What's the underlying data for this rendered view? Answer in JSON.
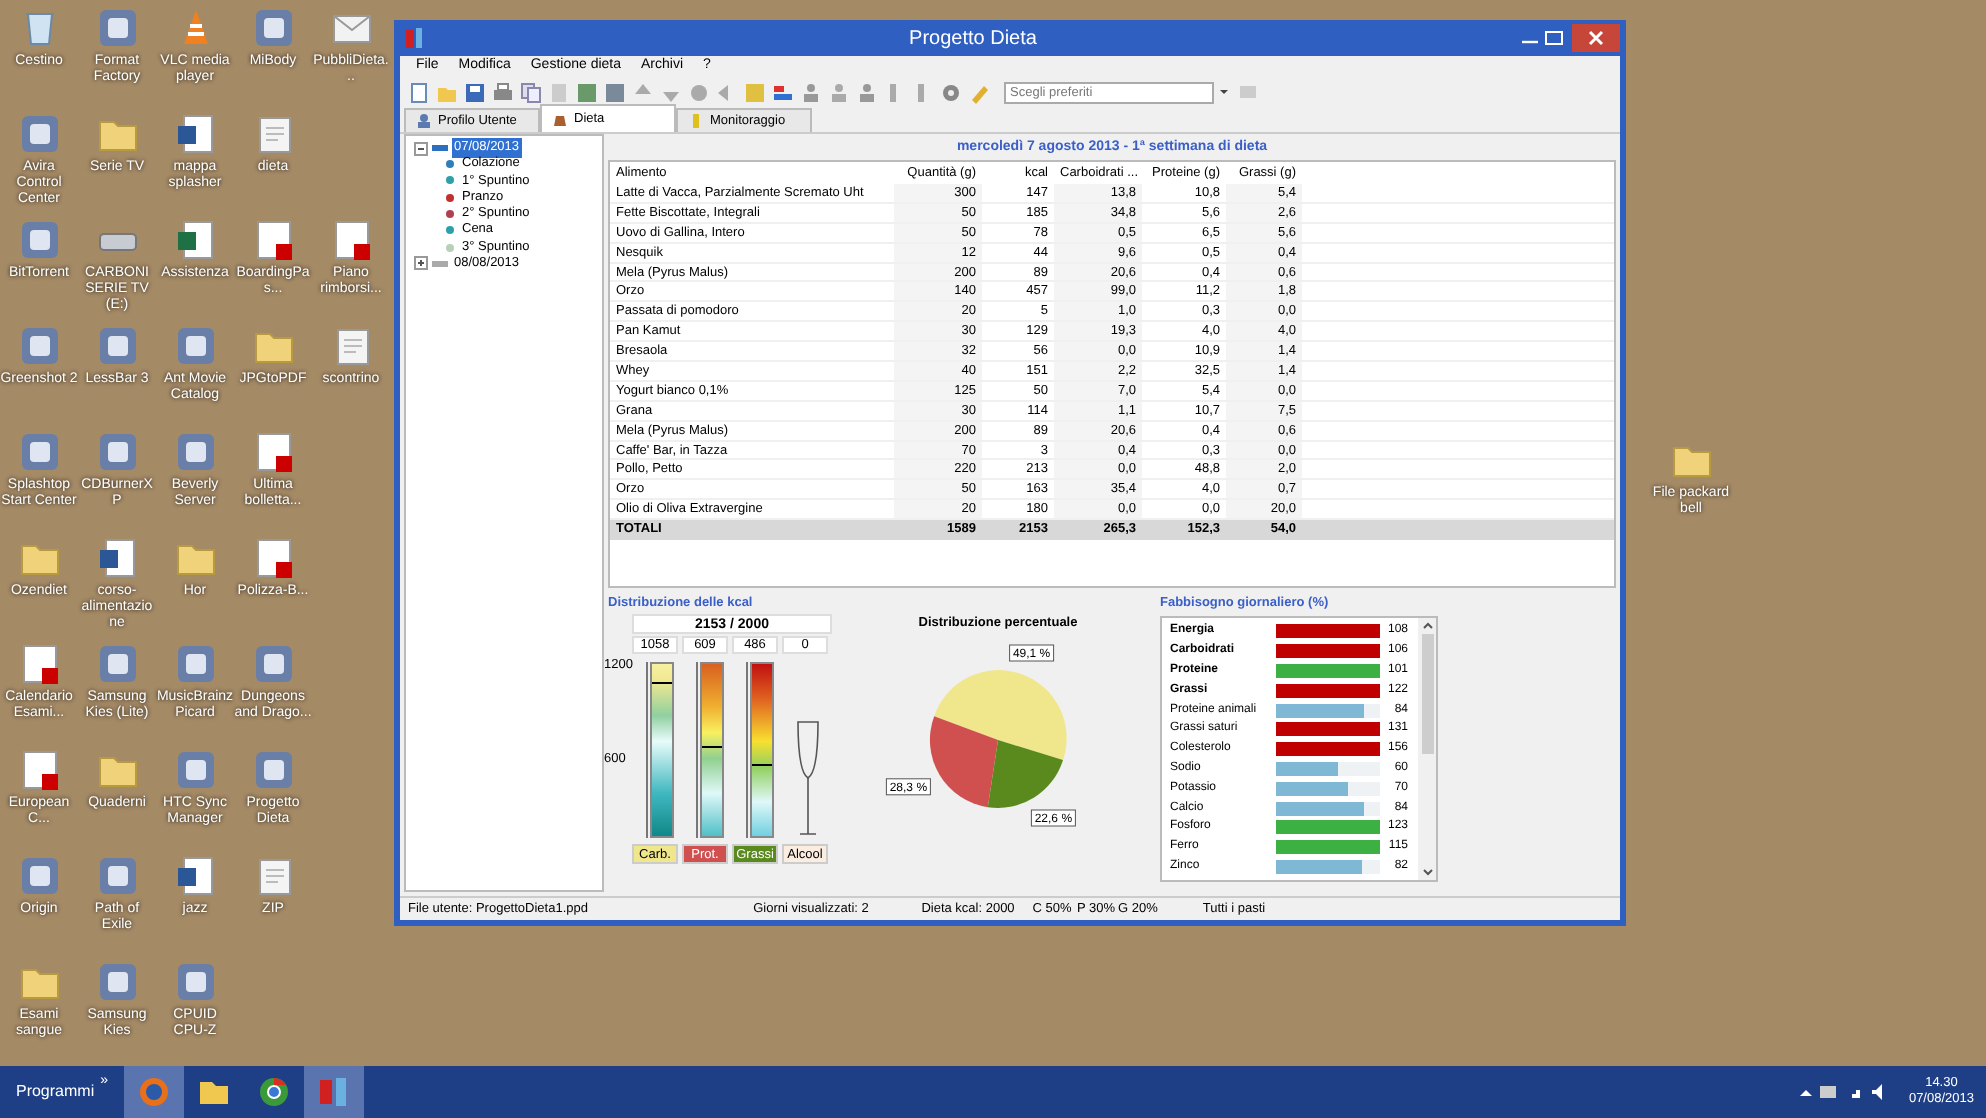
{
  "desktop": {
    "icon_rows": [
      [
        {
          "label": "Cestino",
          "kind": "recycle"
        },
        {
          "label": "Format Factory",
          "kind": "app"
        },
        {
          "label": "VLC media player",
          "kind": "cone"
        },
        {
          "label": "MiBody",
          "kind": "app"
        },
        {
          "label": "PubbliDieta...",
          "kind": "mail"
        }
      ],
      [
        {
          "label": "Avira Control Center",
          "kind": "app"
        },
        {
          "label": "Serie TV",
          "kind": "folder"
        },
        {
          "label": "mappa splasher",
          "kind": "word"
        },
        {
          "label": "dieta",
          "kind": "doc"
        }
      ],
      [
        {
          "label": "BitTorrent",
          "kind": "app"
        },
        {
          "label": "CARBONI SERIE TV (E:)",
          "kind": "drive"
        },
        {
          "label": "Assistenza",
          "kind": "excel"
        },
        {
          "label": "BoardingPas...",
          "kind": "pdf"
        },
        {
          "label": "Piano rimborsi...",
          "kind": "pdf"
        }
      ],
      [
        {
          "label": "Greenshot 2",
          "kind": "app"
        },
        {
          "label": "LessBar 3",
          "kind": "app"
        },
        {
          "label": "Ant Movie Catalog",
          "kind": "app"
        },
        {
          "label": "JPGtoPDF",
          "kind": "folder"
        },
        {
          "label": "scontrino",
          "kind": "doc"
        }
      ],
      [
        {
          "label": "Splashtop Start Center",
          "kind": "app"
        },
        {
          "label": "CDBurnerXP",
          "kind": "app"
        },
        {
          "label": "Beverly Server",
          "kind": "app"
        },
        {
          "label": "Ultima bolletta...",
          "kind": "pdf"
        }
      ],
      [
        {
          "label": "Ozendiet",
          "kind": "folder"
        },
        {
          "label": "corso-alimentazione",
          "kind": "word"
        },
        {
          "label": "Hor",
          "kind": "folder"
        },
        {
          "label": "Polizza-B...",
          "kind": "pdf"
        }
      ],
      [
        {
          "label": "Calendario Esami...",
          "kind": "pdf"
        },
        {
          "label": "Samsung Kies (Lite)",
          "kind": "app"
        },
        {
          "label": "MusicBrainz Picard",
          "kind": "app"
        },
        {
          "label": "Dungeons and Drago...",
          "kind": "app"
        }
      ],
      [
        {
          "label": "European C...",
          "kind": "pdf"
        },
        {
          "label": "Quaderni",
          "kind": "folder"
        },
        {
          "label": "HTC Sync Manager",
          "kind": "app"
        },
        {
          "label": "Progetto Dieta",
          "kind": "app"
        }
      ],
      [
        {
          "label": "Origin",
          "kind": "app"
        },
        {
          "label": "Path of Exile",
          "kind": "app"
        },
        {
          "label": "jazz",
          "kind": "word"
        },
        {
          "label": "ZIP",
          "kind": "doc"
        }
      ],
      [
        {
          "label": "Esami sangue",
          "kind": "folder"
        },
        {
          "label": "Samsung Kies",
          "kind": "app"
        },
        {
          "label": "CPUID CPU-Z",
          "kind": "app"
        }
      ]
    ],
    "right_icon": {
      "label": "File packard bell",
      "kind": "folder"
    }
  },
  "window": {
    "title": "Progetto Dieta",
    "menu": [
      "File",
      "Modifica",
      "Gestione dieta",
      "Archivi",
      "?"
    ],
    "favorites": {
      "placeholder": "Scegli preferiti"
    },
    "tabs": [
      {
        "label": "Profilo Utente",
        "selected": false
      },
      {
        "label": "Dieta",
        "selected": true
      },
      {
        "label": "Monitoraggio",
        "selected": false
      }
    ],
    "tree": [
      {
        "label": "07/08/2013",
        "selected": true,
        "expanded": true,
        "children": [
          {
            "label": "Colazione",
            "color": "#2c7fb8"
          },
          {
            "label": "1° Spuntino",
            "color": "#2c9fa8"
          },
          {
            "label": "Pranzo",
            "color": "#c03030"
          },
          {
            "label": "2° Spuntino",
            "color": "#b04050"
          },
          {
            "label": "Cena",
            "color": "#2c9fa8"
          },
          {
            "label": "3° Spuntino",
            "color": "#b8d0b8"
          }
        ]
      },
      {
        "label": "08/08/2013",
        "selected": false,
        "expanded": false
      }
    ],
    "day_title": "mercoledì 7 agosto 2013 - 1ª settimana di dieta",
    "table": {
      "columns": [
        "Alimento",
        "Quantità (g)",
        "kcal",
        "Carboidrati ...",
        "Proteine (g)",
        "Grassi (g)"
      ],
      "rows": [
        [
          "Latte di Vacca, Parzialmente Scremato Uht",
          "300",
          "147",
          "13,8",
          "10,8",
          "5,4"
        ],
        [
          "Fette Biscottate, Integrali",
          "50",
          "185",
          "34,8",
          "5,6",
          "2,6"
        ],
        [
          "Uovo di Gallina, Intero",
          "50",
          "78",
          "0,5",
          "6,5",
          "5,6"
        ],
        [
          "Nesquik",
          "12",
          "44",
          "9,6",
          "0,5",
          "0,4"
        ],
        [
          "Mela (Pyrus Malus)",
          "200",
          "89",
          "20,6",
          "0,4",
          "0,6"
        ],
        [
          "Orzo",
          "140",
          "457",
          "99,0",
          "11,2",
          "1,8"
        ],
        [
          "Passata di pomodoro",
          "20",
          "5",
          "1,0",
          "0,3",
          "0,0"
        ],
        [
          "Pan Kamut",
          "30",
          "129",
          "19,3",
          "4,0",
          "4,0"
        ],
        [
          "Bresaola",
          "32",
          "56",
          "0,0",
          "10,9",
          "1,4"
        ],
        [
          "Whey",
          "40",
          "151",
          "2,2",
          "32,5",
          "1,4"
        ],
        [
          "Yogurt bianco 0,1%",
          "125",
          "50",
          "7,0",
          "5,4",
          "0,0"
        ],
        [
          "Grana",
          "30",
          "114",
          "1,1",
          "10,7",
          "7,5"
        ],
        [
          "Mela (Pyrus Malus)",
          "200",
          "89",
          "20,6",
          "0,4",
          "0,6"
        ],
        [
          "Caffe' Bar, in Tazza",
          "70",
          "3",
          "0,4",
          "0,3",
          "0,0"
        ],
        [
          "Pollo, Petto",
          "220",
          "213",
          "0,0",
          "48,8",
          "2,0"
        ],
        [
          "Orzo",
          "50",
          "163",
          "35,4",
          "4,0",
          "0,7"
        ],
        [
          "Olio di Oliva Extravergine",
          "20",
          "180",
          "0,0",
          "0,0",
          "20,0"
        ]
      ],
      "total": [
        "TOTALI",
        "1589",
        "2153",
        "265,3",
        "152,3",
        "54,0"
      ]
    },
    "kcal_panel": {
      "title": "Distribuzione delle kcal",
      "total": "2153 / 2000",
      "values": [
        "1058",
        "609",
        "486",
        "0"
      ],
      "axis": [
        "1200",
        "600"
      ],
      "meters": [
        {
          "label": "Carb.",
          "kind": "carb",
          "level": 0.88
        },
        {
          "label": "Prot.",
          "kind": "prot",
          "level": 0.51
        },
        {
          "label": "Grassi",
          "kind": "fat",
          "level": 0.405
        },
        {
          "label": "Alcool",
          "kind": "glass"
        }
      ]
    },
    "pie": {
      "chart_data": {
        "type": "pie",
        "title": "Distribuzione percentuale",
        "values": [
          49.1,
          28.3,
          22.6
        ],
        "value_labels": [
          "49,1 %",
          "28,3 %",
          "22,6 %"
        ]
      }
    },
    "needs": {
      "title": "Fabbisogno giornaliero (%)",
      "rows": [
        {
          "name": "Energia",
          "kind": "main",
          "level": 1,
          "value": "108",
          "color": "#c00000"
        },
        {
          "name": "Carboidrati",
          "kind": "main",
          "level": 1,
          "value": "106",
          "color": "#c00000"
        },
        {
          "name": "Proteine",
          "kind": "main",
          "level": 1,
          "value": "101",
          "color": "#3cb043"
        },
        {
          "name": "Grassi",
          "kind": "main",
          "level": 1,
          "value": "122",
          "color": "#c00000"
        },
        {
          "name": "Proteine animali",
          "kind": "detail",
          "level": 0.84,
          "value": "84",
          "color": "#7fb8d4"
        },
        {
          "name": "Grassi saturi",
          "kind": "detail",
          "level": 1,
          "value": "131",
          "color": "#c00000"
        },
        {
          "name": "Colesterolo",
          "kind": "detail",
          "level": 1,
          "value": "156",
          "color": "#c00000"
        },
        {
          "name": "Sodio",
          "kind": "detail",
          "level": 0.6,
          "value": "60",
          "color": "#7fb8d4"
        },
        {
          "name": "Potassio",
          "kind": "detail",
          "level": 0.7,
          "value": "70",
          "color": "#7fb8d4"
        },
        {
          "name": "Calcio",
          "kind": "detail",
          "level": 0.84,
          "value": "84",
          "color": "#7fb8d4"
        },
        {
          "name": "Fosforo",
          "kind": "detail",
          "level": 1,
          "value": "123",
          "color": "#3cb043"
        },
        {
          "name": "Ferro",
          "kind": "detail",
          "level": 1,
          "value": "115",
          "color": "#3cb043"
        },
        {
          "name": "Zinco",
          "kind": "detail",
          "level": 0.82,
          "value": "82",
          "color": "#7fb8d4"
        }
      ]
    },
    "status_bar": [
      "File utente: ProgettoDieta1.ppd",
      "Giorni visualizzati: 2",
      "Dieta kcal: 2000",
      "C 50%",
      "P 30%",
      "G 20%",
      "Tutti i pasti"
    ]
  },
  "taskbar": {
    "start": "Programmi",
    "more": "»",
    "apps": [
      {
        "kind": "firefox",
        "selected": true
      },
      {
        "kind": "explorer",
        "selected": false
      },
      {
        "kind": "chrome",
        "selected": false
      },
      {
        "kind": "dieta",
        "selected": true
      }
    ],
    "time": "14.30",
    "date": "07/08/2013"
  }
}
